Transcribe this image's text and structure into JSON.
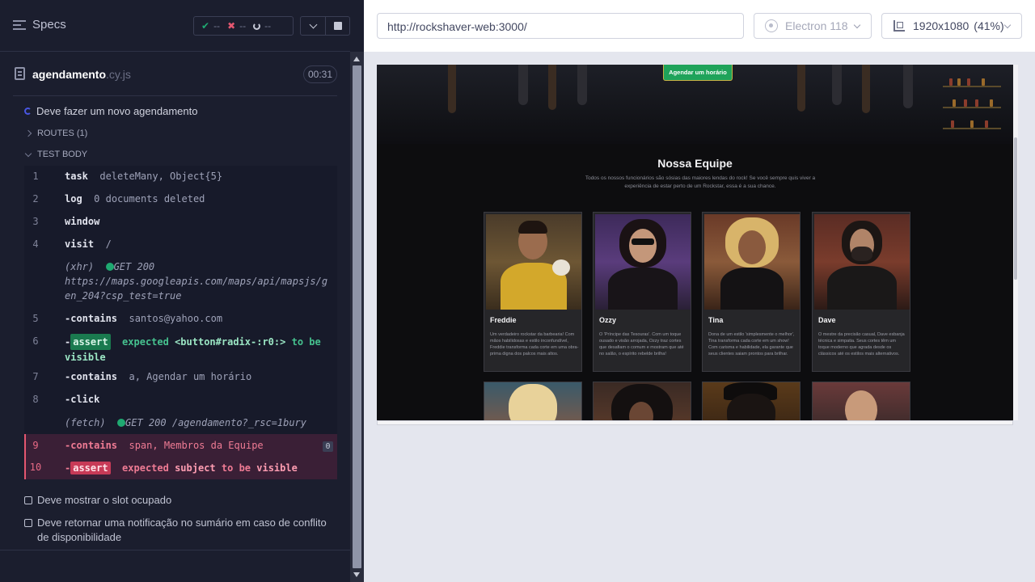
{
  "reporter": {
    "specs_label": "Specs",
    "stats": {
      "passed": "--",
      "failed": "--",
      "pending": "--"
    },
    "spec": {
      "name": "agendamento",
      "ext": ".cy.js",
      "duration": "00:31"
    },
    "running_test": "Deve fazer um novo agendamento",
    "routes_label": "ROUTES (1)",
    "test_body_label": "TEST BODY",
    "commands": [
      {
        "num": "1",
        "name": "task",
        "message": "deleteMany, Object{5}"
      },
      {
        "num": "2",
        "name": "log",
        "message": "0 documents deleted"
      },
      {
        "num": "3",
        "name": "window",
        "message": ""
      },
      {
        "num": "4",
        "name": "visit",
        "message": "/"
      },
      {
        "type_label": "(xhr)",
        "status": "GET 200",
        "url": "https://maps.googleapis.com/maps/api/mapsjs/gen_204?csp_test=true"
      },
      {
        "num": "5",
        "name": "-contains",
        "message": "santos@yahoo.com"
      },
      {
        "num": "6",
        "name": "-",
        "badge": "assert",
        "message_parts": [
          "expected",
          "<button#radix-:r0:>",
          "to be",
          "visible"
        ]
      },
      {
        "num": "7",
        "name": "-contains",
        "message": "a, Agendar um horário"
      },
      {
        "num": "8",
        "name": "-click",
        "message": ""
      },
      {
        "type_label": "(fetch)",
        "status": "GET 200",
        "url": "/agendamento?_rsc=1bury"
      },
      {
        "num": "9",
        "name": "-contains",
        "message": "span, Membros da Equipe",
        "pin": "0"
      },
      {
        "num": "10",
        "name": "-",
        "badge": "assert",
        "message_parts": [
          "expected",
          "subject",
          "to be",
          "visible"
        ]
      }
    ],
    "pending_tests": [
      "Deve mostrar o slot ocupado",
      "Deve retornar uma notificação no sumário em caso de conflito de disponibilidade"
    ]
  },
  "browser": {
    "url": "http://rockshaver-web:3000/",
    "browser_name": "Electron 118",
    "viewport": "1920x1080",
    "scale": "(41%)"
  },
  "aut": {
    "cta_label": "Agendar um horário",
    "team_title": "Nossa Equipe",
    "team_subtitle": "Todos os nossos funcionários são sósias das maiores lendas do rock! Se você sempre quis viver a experiência de estar perto de um Rockstar, essa é a sua chance.",
    "members": [
      {
        "name": "Freddie",
        "bio": "Um verdadeiro rockstar da barbearia! Com mãos habilidosas e estilo inconfundível, Freddie transforma cada corte em uma obra-prima digna dos palcos mais altos."
      },
      {
        "name": "Ozzy",
        "bio": "O 'Príncipe das Tesouras'. Com um toque ousado e visão arrojada, Ozzy traz cortes que desafiam o comum e mostram que até no salão, o espírito rebelde brilha!"
      },
      {
        "name": "Tina",
        "bio": "Dona de um estilo 'simplesmente o melhor', Tina transforma cada corte em um show! Com carisma e habilidade, ela garante que seus clientes saiam prontos para brilhar."
      },
      {
        "name": "Dave",
        "bio": "O mestre da precisão casual, Dave esbanja técnica e simpatia. Seus cortes têm um toque moderno que agrada desde os clássicos até os estilos mais alternativos."
      }
    ]
  },
  "colors": {
    "pass": "#1fa971",
    "fail": "#e45770",
    "accent": "#4956e3",
    "cta": "#1fa35a"
  }
}
